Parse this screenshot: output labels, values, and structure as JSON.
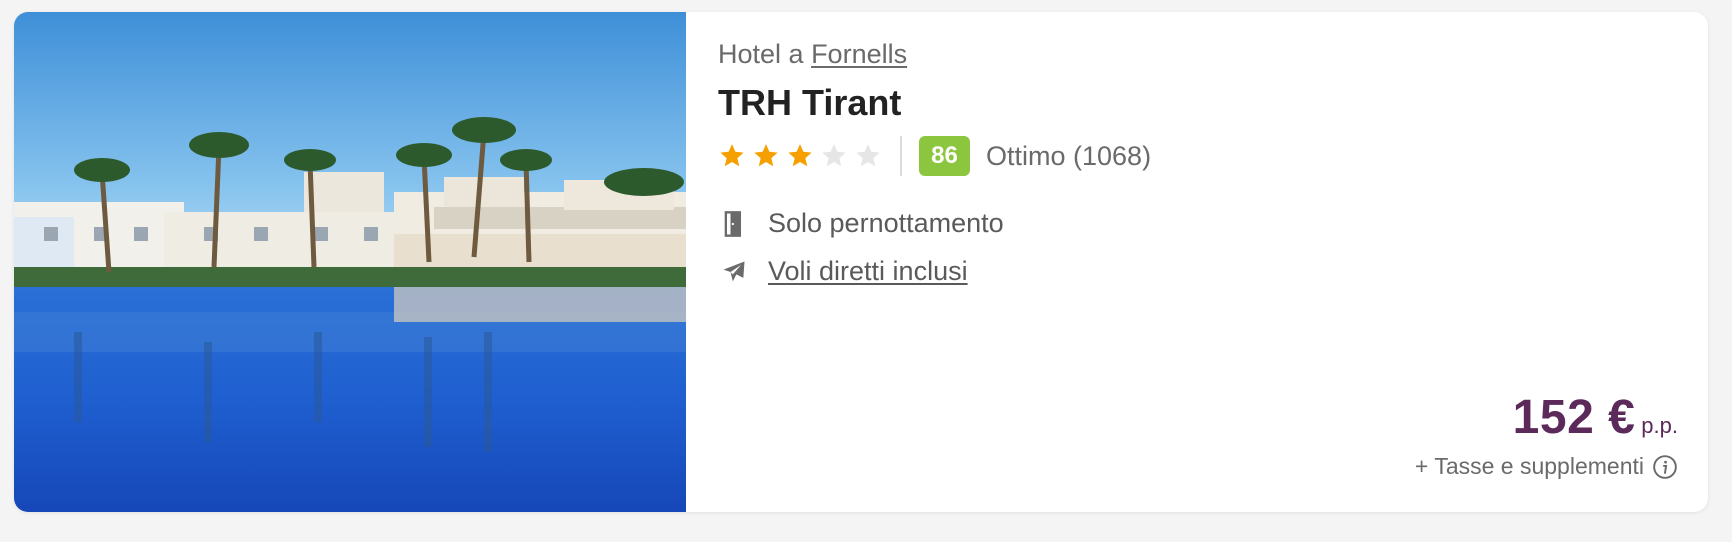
{
  "hotel": {
    "location_prefix": "Hotel a ",
    "location_city": "Fornells",
    "name": "TRH Tirant",
    "stars": 3,
    "max_stars": 5,
    "score": "86",
    "score_label": "Ottimo (1068)",
    "image_icon": "hotel-pool-photo"
  },
  "features": {
    "board": {
      "label": "Solo pernottamento",
      "icon": "door-icon"
    },
    "flights": {
      "label": "Voli diretti inclusi",
      "icon": "plane-icon"
    }
  },
  "price": {
    "amount": "152 €",
    "unit": "p.p.",
    "taxes": "+ Tasse e supplementi",
    "info_icon": "info-icon"
  },
  "colors": {
    "star_filled": "#f5a000",
    "star_empty": "#e6e6e6",
    "score_badge": "#8cc63f",
    "price": "#5b2a5a"
  }
}
